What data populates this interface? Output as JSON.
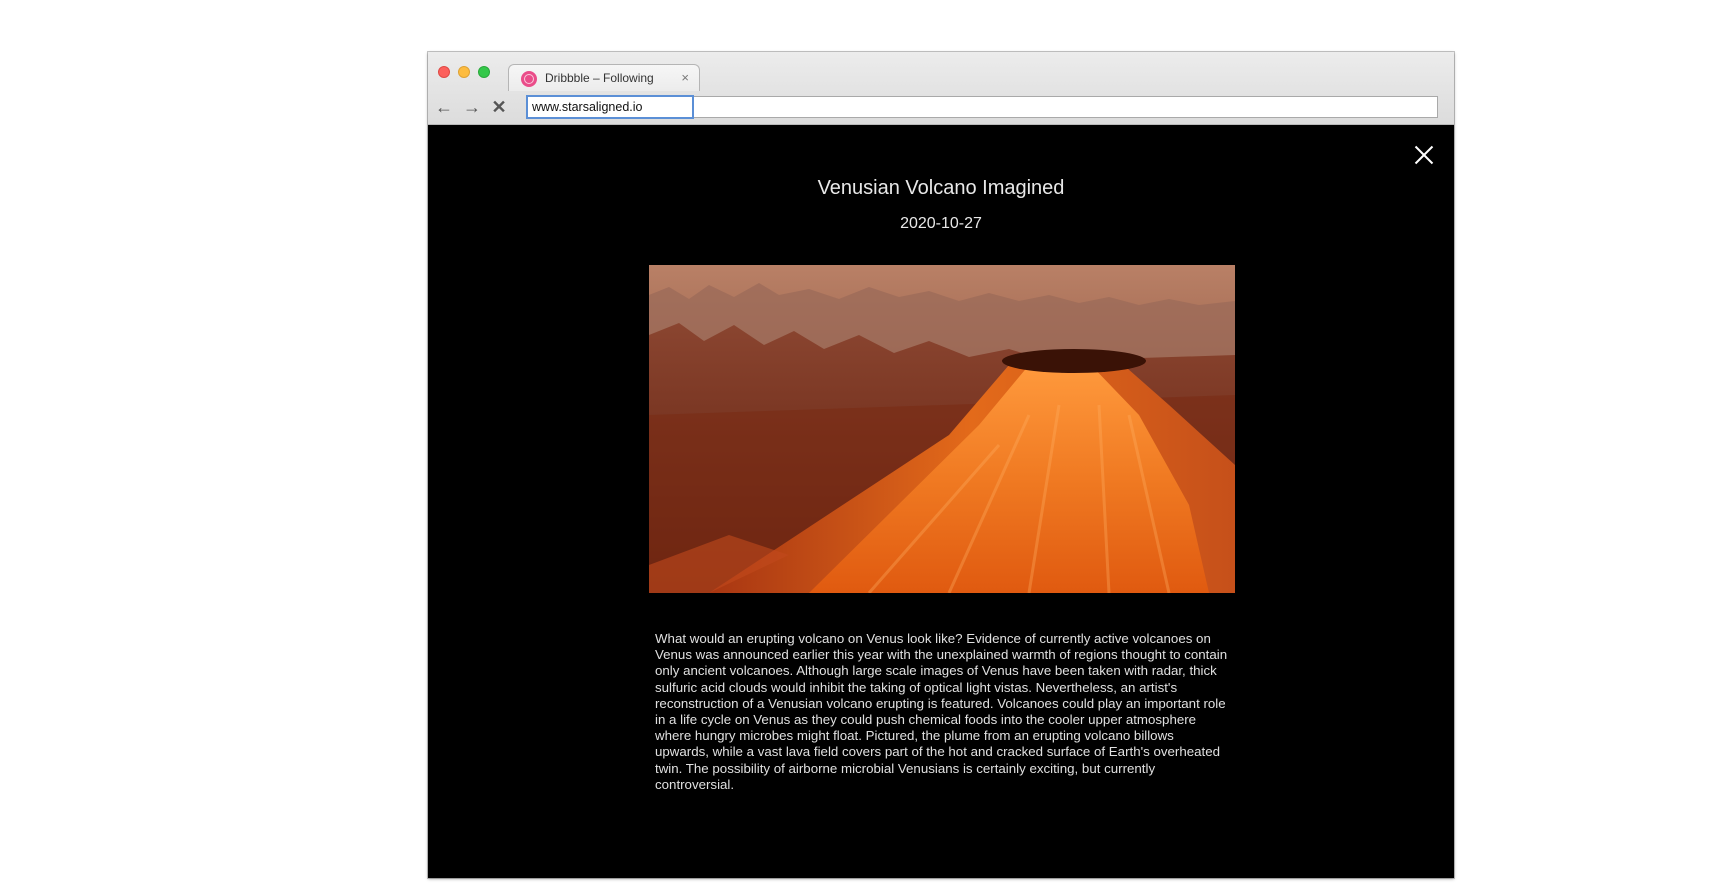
{
  "browser": {
    "tab": {
      "title": "Dribbble – Following",
      "close_label": "×",
      "favicon": "dribbble-icon"
    },
    "nav": {
      "back": "back-arrow-icon",
      "forward": "forward-arrow-icon",
      "stop": "stop-icon"
    },
    "url": "www.starsaligned.io"
  },
  "page": {
    "title": "Venusian Volcano Imagined",
    "date": "2020-10-27",
    "image_subject": "orange lava volcano on Venus",
    "description": "What would an erupting volcano on Venus look like? Evidence of currently active volcanoes on Venus was announced earlier this year with the unexplained warmth of regions thought to contain only ancient volcanoes. Although large scale images of Venus have been taken with radar, thick sulfuric acid clouds would inhibit the taking of optical light vistas. Nevertheless, an artist's reconstruction of a Venusian volcano erupting is featured. Volcanoes could play an important role in a life cycle on Venus as they could push chemical foods into the cooler upper atmosphere where hungry microbes might float. Pictured, the plume from an erupting volcano billows upwards, while a vast lava field covers part of the hot and cracked surface of Earth's overheated twin. The possibility of airborne microbial Venusians is certainly exciting, but currently controversial."
  },
  "colors": {
    "accent": "#ea4c89",
    "background": "#000000",
    "text": "#e8e8e8",
    "lava": "#e8661f"
  }
}
